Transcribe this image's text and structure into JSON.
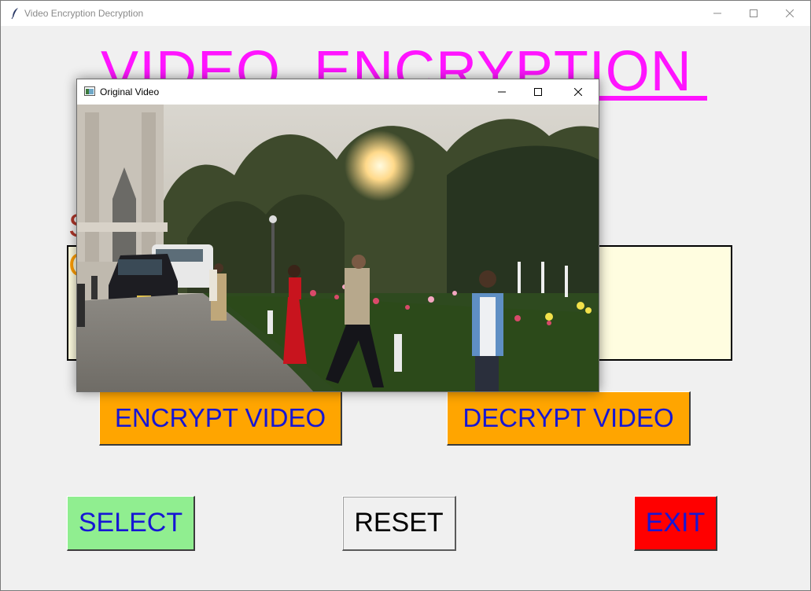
{
  "main_window": {
    "title": "Video Encryption Decryption",
    "heading": "VIDEO  ENCRYPTION",
    "label_partial_1": "S",
    "label_partial_2": "C",
    "buttons": {
      "encrypt": "ENCRYPT VIDEO",
      "decrypt": "DECRYPT VIDEO",
      "select": "SELECT",
      "reset": "RESET",
      "exit": "EXIT"
    }
  },
  "video_window": {
    "title": "Original Video"
  },
  "colors": {
    "heading": "#ff14ff",
    "encrypt_button": "#ffa500",
    "select_button": "#90ee90",
    "exit_button": "#ff0000",
    "button_text": "#1616d4",
    "path_box": "#fffde0"
  },
  "icons": {
    "app": "feather-icon",
    "video_window": "window-icon",
    "minimize": "minimize-icon",
    "maximize": "maximize-icon",
    "close": "close-icon"
  }
}
